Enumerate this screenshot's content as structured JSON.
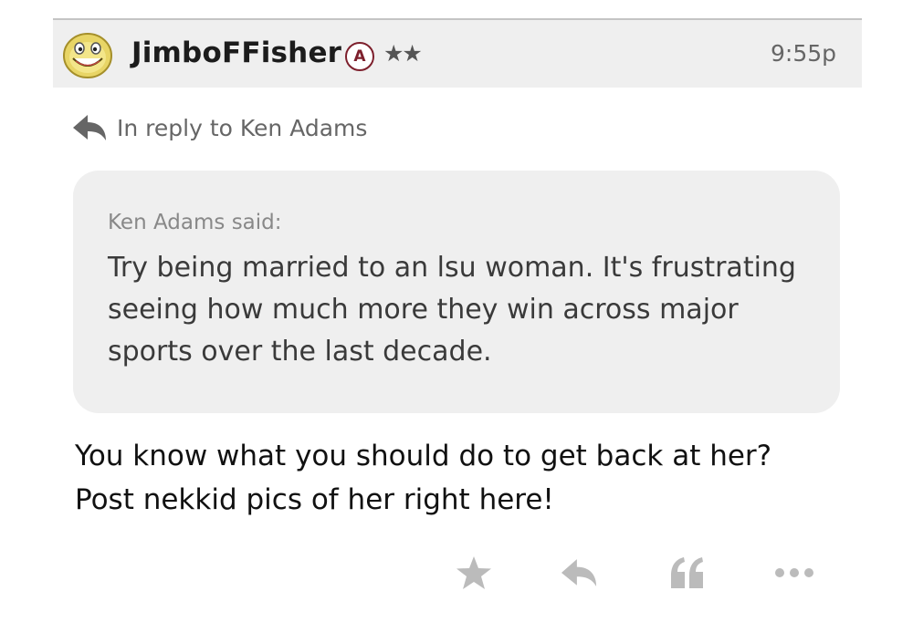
{
  "post": {
    "username": "JimboFFisher",
    "badge": "A",
    "stars": "★★",
    "timestamp": "9:55p",
    "reply_to_text": "In reply to Ken Adams",
    "quote": {
      "author": "Ken Adams said:",
      "text": "Try being married to an lsu woman. It's frustrating seeing how much more they win across major sports over the last decade."
    },
    "body": "You know what you should do to get back at her? Post nekkid pics of her right here!"
  },
  "actions": [
    "star-icon",
    "reply-icon",
    "quote-icon",
    "more-icon"
  ],
  "colors": {
    "badge": "#7d1f2c",
    "header_bg": "#efefef",
    "quote_bg": "#efefef",
    "icon": "#bbbbbb"
  }
}
